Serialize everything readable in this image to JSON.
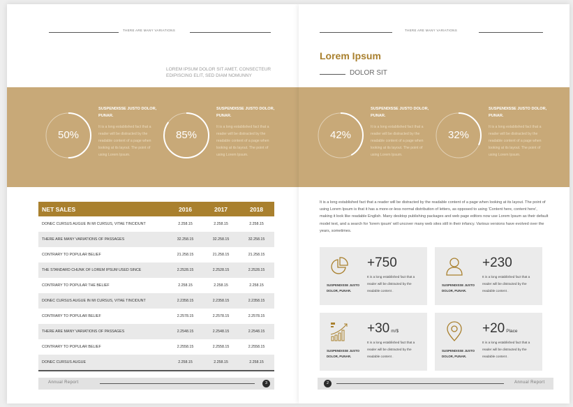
{
  "left_page": {
    "header_text": "THERE ARE MANY VARIATIONS",
    "intro_caption": "LOREM IPSUM DOLOR SIT AMET, CONSECTEUR EDIPISCING ELIT, SED DIAM NOMUNNY",
    "stats": [
      {
        "percent": "50%",
        "value": 50,
        "title": "SUSPENDISSE JUSTO DOLOR, PUNAR.",
        "body": "It is a long established fact that a reader will be distracted by the readable content of a page when looking at its layout. The point of using Lorem Ipsum."
      },
      {
        "percent": "85%",
        "value": 85,
        "title": "SUSPENDISSE JUSTO DOLOR, PUNAR.",
        "body": "It is a long established fact that a reader will be distracted by the readable content of a page when looking at its layout. The point of using Lorem Ipsum."
      }
    ],
    "table": {
      "headers": [
        "NET SALES",
        "2016",
        "2017",
        "2018"
      ],
      "rows": [
        [
          "DONEC CURSUS AUGUE IN MI CURSUS, VITAE TINCIDUNT",
          "2.258.15",
          "2.258.15",
          "2.258.15"
        ],
        [
          "THERE ARE MANY VARIATIONS OF PASSAGES",
          "32.258.15",
          "32.258.15",
          "32.258.15"
        ],
        [
          "CONTRARY TO POPULAR BELIEF",
          "21.258.15",
          "21.258.15",
          "21.258.15"
        ],
        [
          "THE STANDARD CHUNK OF LOREM IPSUM USED SINCE",
          "2.2528.15",
          "2.2528.15",
          "2.2528.15"
        ],
        [
          "CONTRARY TO POPULAR THE BELIEF",
          "2.258.15",
          "2.258.15",
          "2.258.15"
        ],
        [
          "DONEC CURSUS AUGUE IN MI CURSUS, VITAE TINCIDUNT",
          "2.2358.15",
          "2.2358.15",
          "2.2358.15"
        ],
        [
          "CONTRARY TO POPULAR BELIEF",
          "2.2578.15",
          "2.2578.15",
          "2.2578.15"
        ],
        [
          "THERE ARE MANY VARIATIONS OF PASSAGES",
          "2.2548.15",
          "2.2548.15",
          "2.2548.15"
        ],
        [
          "CONTRARY TO POPULAR BELIEF",
          "2.2558.15",
          "2.2558.15",
          "2.2558.15"
        ],
        [
          "DONEC CURSUS AUGUE",
          "2.258.15",
          "2.258.15",
          "2.258.15"
        ]
      ]
    },
    "footer": {
      "label": "Annual Report",
      "page_number": "3"
    }
  },
  "right_page": {
    "header_text": "THERE ARE MANY VARIATIONS",
    "title": "Lorem Ipsum",
    "subtitle": "DOLOR SIT",
    "stats": [
      {
        "percent": "42%",
        "value": 42,
        "title": "SUSPENDISSE JUSTO DOLOR, PUNAR.",
        "body": "It is a long established fact that a reader will be distracted by the readable content of a page when looking at its layout. The point of using Lorem Ipsum."
      },
      {
        "percent": "32%",
        "value": 32,
        "title": "SUSPENDISSE JUSTO DOLOR, PUNAR.",
        "body": "It is a long established fact that a reader will be distracted by the readable content of a page when looking at its layout. The point of using Lorem Ipsum."
      }
    ],
    "paragraph": "It is a long established fact that a reader will be distracted by the readable content of a page when looking at its layout. The point of using Lorem Ipsum is that it has a more-or-less normal distribution of letters, as opposed to using 'Content here, content here', making it look like readable English. Many desktop publishing packages and web page editors now use Lorem Ipsum as their default model text, and a search for 'lorem ipsum' will uncover many web sites still in their infancy. Various versions have evolved over the years, sometimes.",
    "cards": [
      {
        "icon": "pie-chart-icon",
        "number": "+750",
        "unit": "",
        "label": "SUSPENDISSE JUSTO DOLOR, PUNAR.",
        "desc": "It is a long established fact that a reader will be distracted by the readable content ."
      },
      {
        "icon": "user-icon",
        "number": "+230",
        "unit": "",
        "label": "SUSPENDISSE JUSTO DOLOR, PUNAR.",
        "desc": "It is a long established fact that a reader will be distracted by the readable content ."
      },
      {
        "icon": "bar-growth-icon",
        "number": "+30",
        "unit": "m/$",
        "label": "SUSPENDISSE JUSTO DOLOR, PUNAR.",
        "desc": "It is a long established fact that a reader will be distracted by the readable content ."
      },
      {
        "icon": "location-pin-icon",
        "number": "+20",
        "unit": "Place",
        "label": "SUSPENDISSE JUSTO DOLOR, PUNAR.",
        "desc": "It is a long established fact that a reader will be distracted by the readable content ."
      }
    ],
    "footer": {
      "label": "Annual Report",
      "page_number": "2"
    }
  },
  "colors": {
    "accent": "#a9802e",
    "band": "#c8a978",
    "card_bg": "#ebebeb"
  }
}
